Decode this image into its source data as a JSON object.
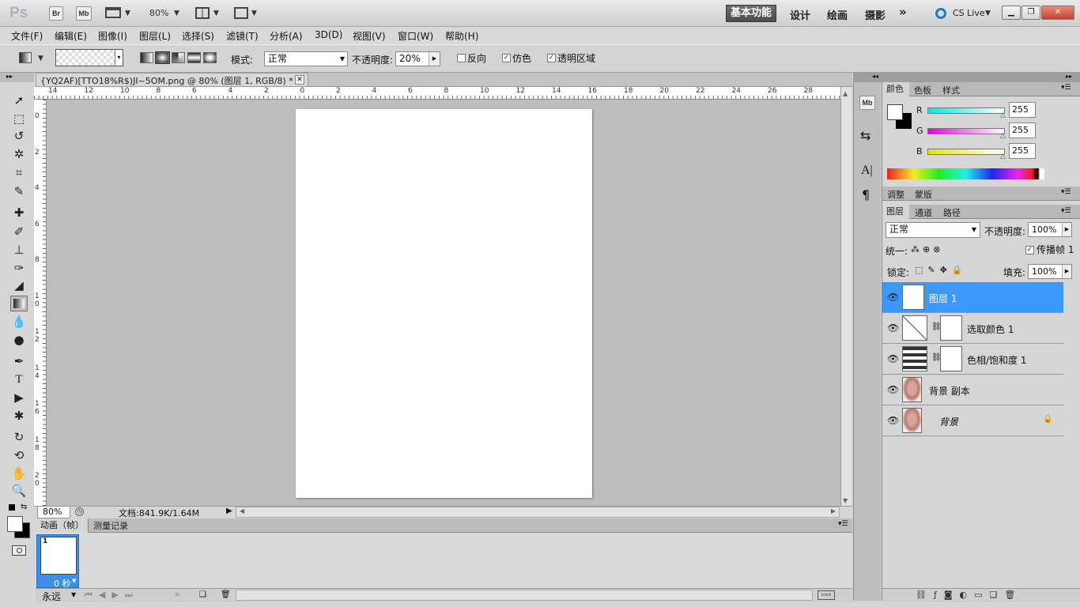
{
  "app": {
    "logo": "Ps",
    "bridge": "Br",
    "minibridge": "Mb",
    "zoom": "80%",
    "workspaces": [
      "基本功能",
      "设计",
      "绘画",
      "摄影"
    ],
    "more": "»",
    "cslive": "CS Live"
  },
  "menu": [
    "文件(F)",
    "编辑(E)",
    "图像(I)",
    "图层(L)",
    "选择(S)",
    "滤镜(T)",
    "分析(A)",
    "3D(D)",
    "视图(V)",
    "窗口(W)",
    "帮助(H)"
  ],
  "options": {
    "mode_label": "模式:",
    "mode_value": "正常",
    "opacity_label": "不透明度:",
    "opacity_value": "20%",
    "reverse": "反向",
    "dither": "仿色",
    "transparency": "透明区域"
  },
  "document": {
    "tab_title": "{YQ2AF)[TTO18%R$)JI~5OM.png @ 80% (图层 1, RGB/8) *",
    "status_zoom": "80%",
    "status_doc": "文档:841.9K/1.64M"
  },
  "rulers": {
    "top": [
      "14",
      "12",
      "10",
      "8",
      "6",
      "4",
      "2",
      "0",
      "2",
      "4",
      "6",
      "8",
      "10",
      "12",
      "14",
      "16",
      "18",
      "20",
      "22",
      "24",
      "26",
      "28",
      "30"
    ],
    "left": [
      "0",
      "2",
      "4",
      "6",
      "8",
      "1 0",
      "1 2",
      "1 4",
      "1 6",
      "1 8",
      "2 0"
    ]
  },
  "animation": {
    "tab1": "动画（帧）",
    "tab2": "测量记录",
    "frame_number": "1",
    "frame_delay": "0 秒",
    "loop": "永远"
  },
  "color_panel": {
    "tabs": [
      "颜色",
      "色板",
      "样式"
    ],
    "channels": [
      {
        "name": "R",
        "value": "255",
        "gradient_from": "#ffffff",
        "gradient_to": "#00e5e5"
      },
      {
        "name": "G",
        "value": "255",
        "gradient_from": "#ffffff",
        "gradient_to": "#e500e5"
      },
      {
        "name": "B",
        "value": "255",
        "gradient_from": "#ffffff",
        "gradient_to": "#e5e500"
      }
    ]
  },
  "adjust_panel": {
    "tabs": [
      "调整",
      "蒙版"
    ]
  },
  "layers_panel": {
    "tabs": [
      "图层",
      "通道",
      "路径"
    ],
    "blend": "正常",
    "opacity_label": "不透明度:",
    "opacity": "100%",
    "unify_label": "统一:",
    "propagate": "传播帧 1",
    "lock_label": "锁定:",
    "fill_label": "填充:",
    "fill": "100%",
    "layers": [
      {
        "name": "图层 1",
        "selected": true
      },
      {
        "name": "选取颜色 1",
        "selected": false
      },
      {
        "name": "色相/饱和度 1",
        "selected": false
      },
      {
        "name": "背景 副本",
        "selected": false
      },
      {
        "name": "背景",
        "selected": false
      }
    ]
  },
  "colors": {
    "accent": "#3a98ff"
  }
}
